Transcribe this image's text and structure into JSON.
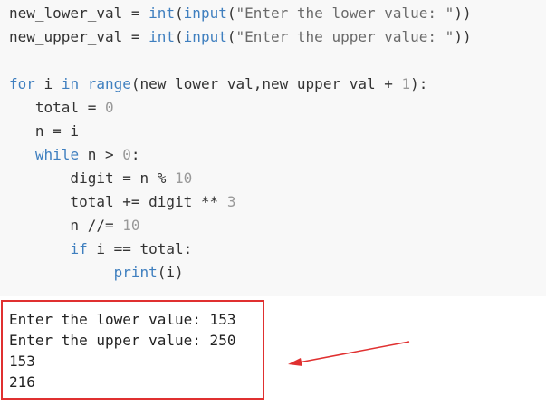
{
  "code": {
    "lines": [
      [
        {
          "t": "new_lower_val = ",
          "c": "op"
        },
        {
          "t": "int",
          "c": "fn"
        },
        {
          "t": "(",
          "c": "op"
        },
        {
          "t": "input",
          "c": "fn"
        },
        {
          "t": "(",
          "c": "op"
        },
        {
          "t": "\"Enter the lower value: \"",
          "c": "str"
        },
        {
          "t": "))",
          "c": "op"
        }
      ],
      [
        {
          "t": "new_upper_val = ",
          "c": "op"
        },
        {
          "t": "int",
          "c": "fn"
        },
        {
          "t": "(",
          "c": "op"
        },
        {
          "t": "input",
          "c": "fn"
        },
        {
          "t": "(",
          "c": "op"
        },
        {
          "t": "\"Enter the upper value: \"",
          "c": "str"
        },
        {
          "t": "))",
          "c": "op"
        }
      ],
      [],
      [
        {
          "t": "for",
          "c": "kw"
        },
        {
          "t": " i ",
          "c": "op"
        },
        {
          "t": "in",
          "c": "kw"
        },
        {
          "t": " ",
          "c": "op"
        },
        {
          "t": "range",
          "c": "fn"
        },
        {
          "t": "(new_lower_val,new_upper_val + ",
          "c": "op"
        },
        {
          "t": "1",
          "c": "num"
        },
        {
          "t": "):",
          "c": "op"
        }
      ],
      [
        {
          "t": "   total = ",
          "c": "op"
        },
        {
          "t": "0",
          "c": "num"
        }
      ],
      [
        {
          "t": "   n = i",
          "c": "op"
        }
      ],
      [
        {
          "t": "   ",
          "c": "op"
        },
        {
          "t": "while",
          "c": "kw"
        },
        {
          "t": " n > ",
          "c": "op"
        },
        {
          "t": "0",
          "c": "num"
        },
        {
          "t": ":",
          "c": "op"
        }
      ],
      [
        {
          "t": "       digit = n % ",
          "c": "op"
        },
        {
          "t": "10",
          "c": "num"
        }
      ],
      [
        {
          "t": "       total += digit ** ",
          "c": "op"
        },
        {
          "t": "3",
          "c": "num"
        }
      ],
      [
        {
          "t": "       n //= ",
          "c": "op"
        },
        {
          "t": "10",
          "c": "num"
        }
      ],
      [
        {
          "t": "       ",
          "c": "op"
        },
        {
          "t": "if",
          "c": "kw"
        },
        {
          "t": " i == total:",
          "c": "op"
        }
      ],
      [
        {
          "t": "            ",
          "c": "op"
        },
        {
          "t": "print",
          "c": "fn"
        },
        {
          "t": "(i)",
          "c": "op"
        }
      ]
    ]
  },
  "output": {
    "lines": [
      "Enter the lower value: 153",
      "Enter the upper value: 250",
      "153",
      "216"
    ]
  },
  "colors": {
    "highlight_border": "#e03030",
    "arrow": "#e03030",
    "code_background": "#f8f8f8"
  }
}
